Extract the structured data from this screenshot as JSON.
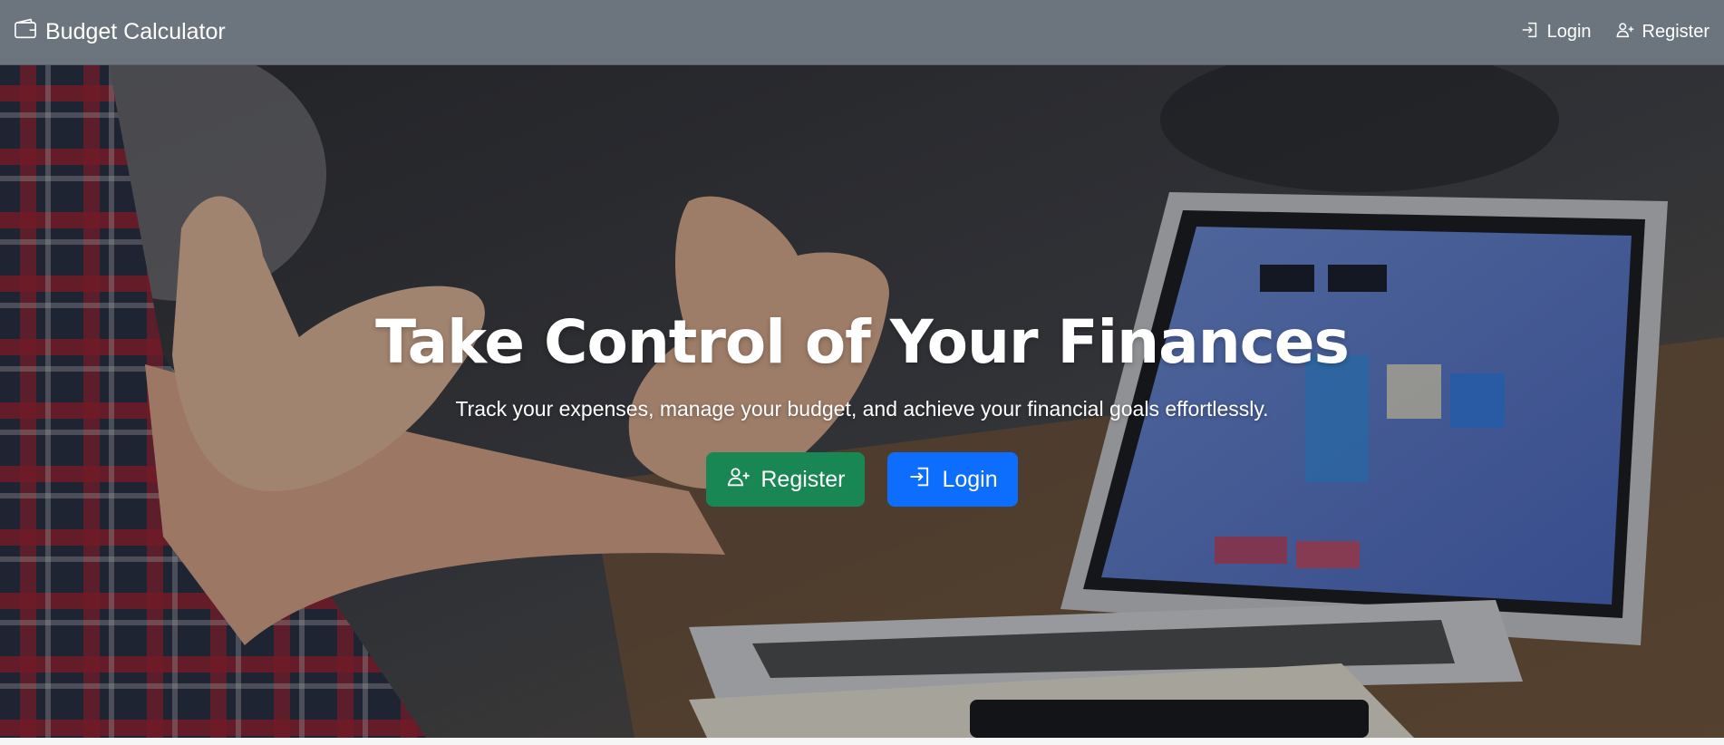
{
  "navbar": {
    "brand_label": "Budget Calculator",
    "brand_icon": "wallet-icon",
    "links": [
      {
        "label": "Login",
        "icon": "login-icon"
      },
      {
        "label": "Register",
        "icon": "person-plus-icon"
      }
    ],
    "background": "#6c757d"
  },
  "hero": {
    "title": "Take Control of Your Finances",
    "subtitle": "Track your expenses, manage your budget, and achieve your financial goals effortlessly.",
    "register_button": {
      "label": "Register",
      "icon": "person-plus-icon",
      "color": "#198754"
    },
    "login_button": {
      "label": "Login",
      "icon": "login-icon",
      "color": "#0d6efd"
    }
  }
}
